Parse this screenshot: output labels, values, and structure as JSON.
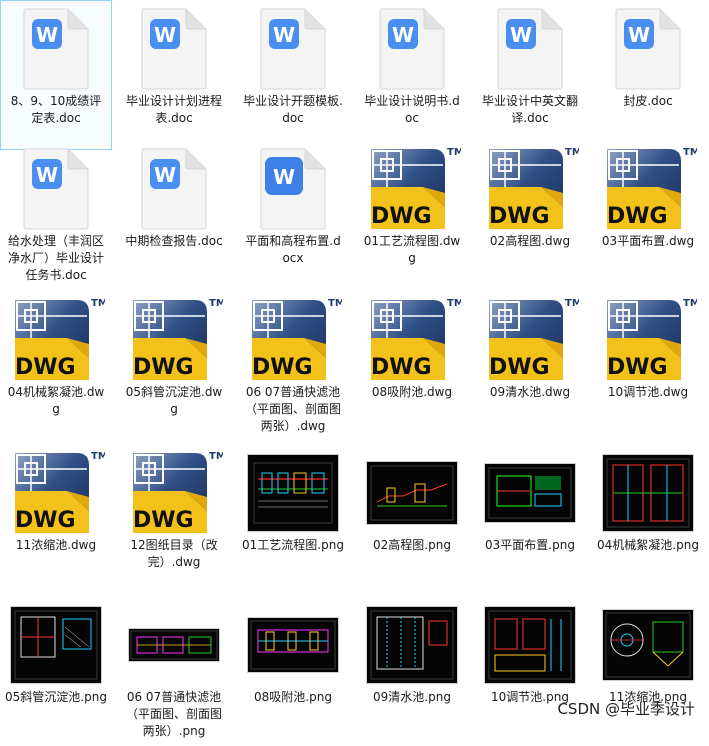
{
  "files": [
    {
      "name": "8、9、10成绩评定表.doc",
      "type": "doc",
      "selected": true
    },
    {
      "name": "毕业设计计划进程表.doc",
      "type": "doc"
    },
    {
      "name": "毕业设计开题模板.doc",
      "type": "doc"
    },
    {
      "name": "毕业设计说明书.doc",
      "type": "doc"
    },
    {
      "name": "毕业设计中英文翻译.doc",
      "type": "doc"
    },
    {
      "name": "封皮.doc",
      "type": "doc"
    },
    {
      "name": "给水处理（丰润区净水厂）毕业设计任务书.doc",
      "type": "doc"
    },
    {
      "name": "中期检查报告.doc",
      "type": "doc"
    },
    {
      "name": "平面和高程布置.docx",
      "type": "docx"
    },
    {
      "name": "01工艺流程图.dwg",
      "type": "dwg"
    },
    {
      "name": "02高程图.dwg",
      "type": "dwg"
    },
    {
      "name": "03平面布置.dwg",
      "type": "dwg"
    },
    {
      "name": "04机械絮凝池.dwg",
      "type": "dwg"
    },
    {
      "name": "05斜管沉淀池.dwg",
      "type": "dwg"
    },
    {
      "name": "06 07普通快滤池（平面图、剖面图两张）.dwg",
      "type": "dwg"
    },
    {
      "name": "08吸附池.dwg",
      "type": "dwg"
    },
    {
      "name": "09清水池.dwg",
      "type": "dwg"
    },
    {
      "name": "10调节池.dwg",
      "type": "dwg"
    },
    {
      "name": "11浓缩池.dwg",
      "type": "dwg"
    },
    {
      "name": "12图纸目录（改完）.dwg",
      "type": "dwg"
    },
    {
      "name": "01工艺流程图.png",
      "type": "png",
      "thumb": "flow"
    },
    {
      "name": "02高程图.png",
      "type": "png",
      "thumb": "profile"
    },
    {
      "name": "03平面布置.png",
      "type": "png",
      "thumb": "plan"
    },
    {
      "name": "04机械絮凝池.png",
      "type": "png",
      "thumb": "tank"
    },
    {
      "name": "05斜管沉淀池.png",
      "type": "png",
      "thumb": "settle"
    },
    {
      "name": "06 07普通快滤池（平面图、剖面图两张）.png",
      "type": "png",
      "thumb": "filter"
    },
    {
      "name": "08吸附池.png",
      "type": "png",
      "thumb": "adsorb"
    },
    {
      "name": "09清水池.png",
      "type": "png",
      "thumb": "clear"
    },
    {
      "name": "10调节池.png",
      "type": "png",
      "thumb": "regulate"
    },
    {
      "name": "11浓缩池.png",
      "type": "png",
      "thumb": "thicken"
    }
  ],
  "icons": {
    "doc": "word-document-icon",
    "docx": "word-document-icon",
    "dwg": "autocad-dwg-icon",
    "png": "cad-drawing-thumbnail"
  },
  "colors": {
    "word_blue": "#4a8ff0",
    "dwg_yellow": "#f2c21b",
    "dwg_navy": "#1f3b6a",
    "select_border": "#99d1ff"
  },
  "dwg_badge": "DWG",
  "dwg_tm": "TM",
  "word_glyph": "W",
  "watermark": "CSDN @毕业季设计"
}
